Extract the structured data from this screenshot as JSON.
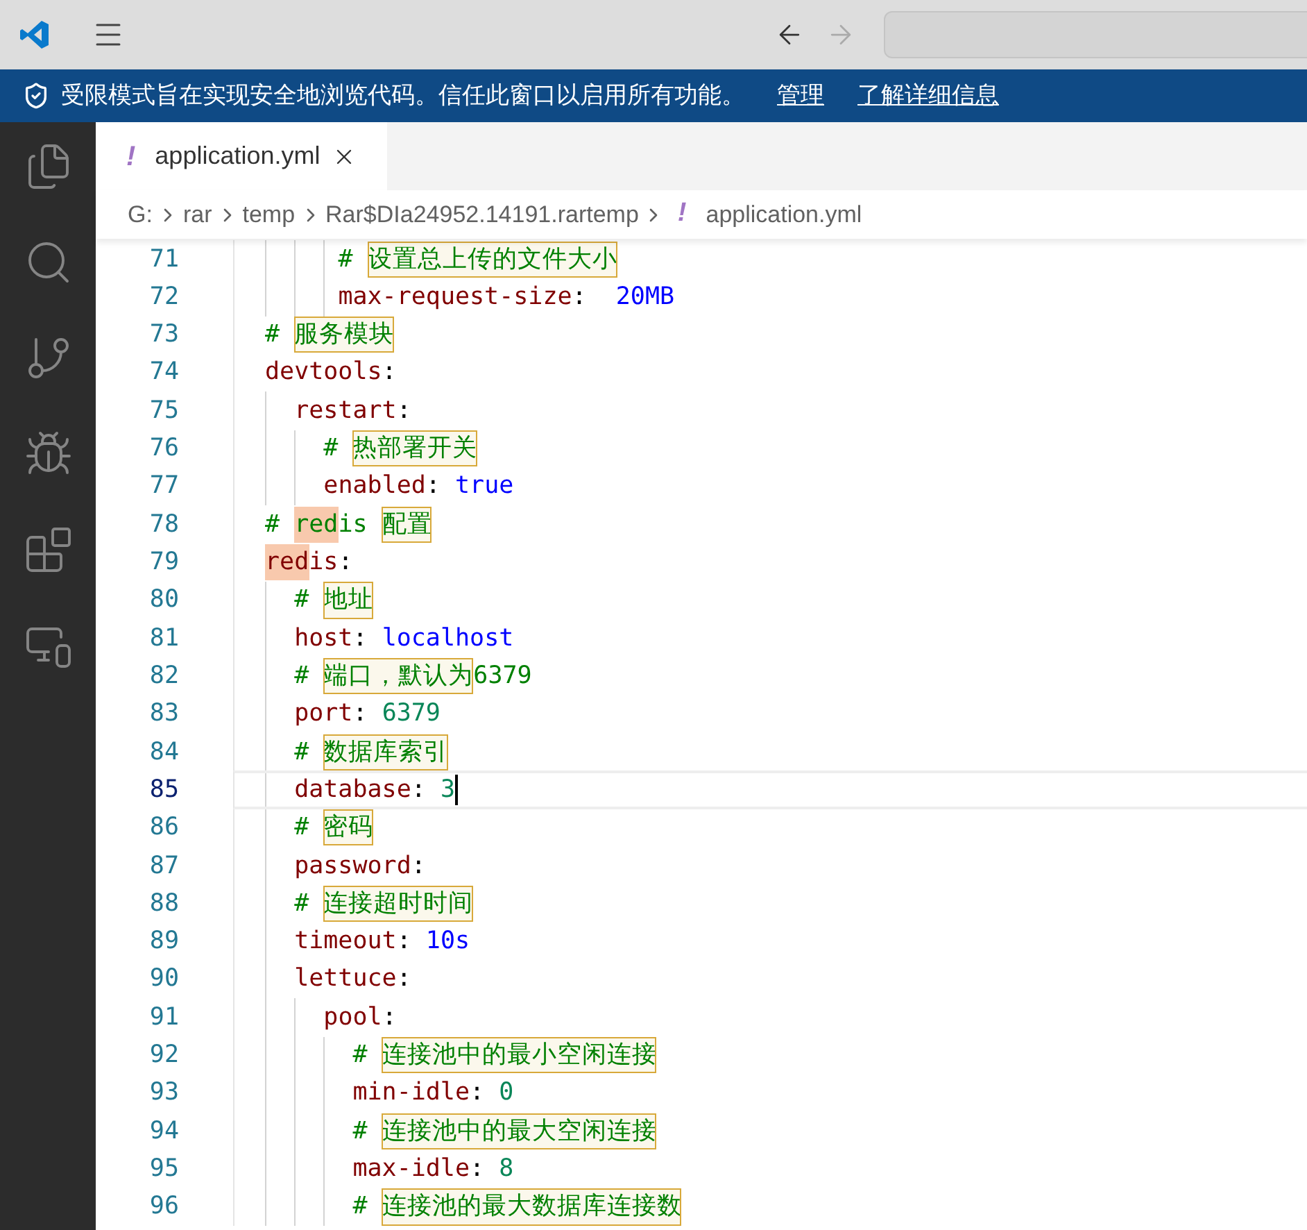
{
  "banner": {
    "message": "受限模式旨在实现安全地浏览代码。信任此窗口以启用所有功能。",
    "links": [
      "管理",
      "了解详细信息"
    ]
  },
  "tabs": [
    {
      "icon": "!",
      "label": "application.yml",
      "selected": true
    }
  ],
  "breadcrumb": {
    "parts": [
      "G:",
      "rar",
      "temp",
      "Rar$DIa24952.14191.rartemp"
    ],
    "file_icon": "!",
    "file": "application.yml"
  },
  "lines": [
    {
      "number": "71",
      "current": false,
      "segments": [
        {
          "kind": "comment",
          "text": "     # "
        },
        {
          "kind": "boxed",
          "text": "设置总上传的文件大小"
        }
      ]
    },
    {
      "number": "72",
      "current": false,
      "segments": [
        {
          "kind": "key",
          "text": "     max-request-size"
        },
        {
          "kind": "punct",
          "text": ":  "
        },
        {
          "kind": "string",
          "text": "20MB"
        }
      ]
    },
    {
      "number": "73",
      "current": false,
      "segments": [
        {
          "kind": "comment",
          "text": "# "
        },
        {
          "kind": "boxed",
          "text": "服务模块"
        }
      ]
    },
    {
      "number": "74",
      "current": false,
      "segments": [
        {
          "kind": "key",
          "text": "devtools"
        },
        {
          "kind": "punct",
          "text": ":"
        }
      ]
    },
    {
      "number": "75",
      "current": false,
      "segments": [
        {
          "kind": "key",
          "text": "  restart"
        },
        {
          "kind": "punct",
          "text": ":"
        }
      ]
    },
    {
      "number": "76",
      "current": false,
      "segments": [
        {
          "kind": "comment",
          "text": "    # "
        },
        {
          "kind": "boxed",
          "text": "热部署开关"
        }
      ]
    },
    {
      "number": "77",
      "current": false,
      "segments": [
        {
          "kind": "key",
          "text": "    enabled"
        },
        {
          "kind": "punct",
          "text": ": "
        },
        {
          "kind": "string",
          "text": "true"
        }
      ]
    },
    {
      "number": "78",
      "current": false,
      "segments": [
        {
          "kind": "comment",
          "text": "# "
        },
        {
          "kind": "match",
          "text": "red"
        },
        {
          "kind": "comment",
          "text": "is "
        },
        {
          "kind": "boxed",
          "text": "配置"
        }
      ]
    },
    {
      "number": "79",
      "current": false,
      "segments": [
        {
          "kind": "keymatch",
          "text": "red"
        },
        {
          "kind": "key",
          "text": "is"
        },
        {
          "kind": "punct",
          "text": ":"
        }
      ]
    },
    {
      "number": "80",
      "current": false,
      "segments": [
        {
          "kind": "comment",
          "text": "  # "
        },
        {
          "kind": "boxed",
          "text": "地址"
        }
      ]
    },
    {
      "number": "81",
      "current": false,
      "segments": [
        {
          "kind": "key",
          "text": "  host"
        },
        {
          "kind": "punct",
          "text": ": "
        },
        {
          "kind": "string",
          "text": "localhost"
        }
      ]
    },
    {
      "number": "82",
      "current": false,
      "segments": [
        {
          "kind": "comment",
          "text": "  # "
        },
        {
          "kind": "boxed",
          "text": "端口，默认为"
        },
        {
          "kind": "comment",
          "text": "6379"
        }
      ]
    },
    {
      "number": "83",
      "current": false,
      "segments": [
        {
          "kind": "key",
          "text": "  port"
        },
        {
          "kind": "punct",
          "text": ": "
        },
        {
          "kind": "number",
          "text": "6379"
        }
      ]
    },
    {
      "number": "84",
      "current": false,
      "segments": [
        {
          "kind": "comment",
          "text": "  # "
        },
        {
          "kind": "boxed",
          "text": "数据库索引"
        }
      ]
    },
    {
      "number": "85",
      "current": true,
      "segments": [
        {
          "kind": "key",
          "text": "  database"
        },
        {
          "kind": "punct",
          "text": ": "
        },
        {
          "kind": "number",
          "text": "3"
        }
      ]
    },
    {
      "number": "86",
      "current": false,
      "segments": [
        {
          "kind": "comment",
          "text": "  # "
        },
        {
          "kind": "boxed",
          "text": "密码"
        }
      ]
    },
    {
      "number": "87",
      "current": false,
      "segments": [
        {
          "kind": "key",
          "text": "  password"
        },
        {
          "kind": "punct",
          "text": ":"
        }
      ]
    },
    {
      "number": "88",
      "current": false,
      "segments": [
        {
          "kind": "comment",
          "text": "  # "
        },
        {
          "kind": "boxed",
          "text": "连接超时时间"
        }
      ]
    },
    {
      "number": "89",
      "current": false,
      "segments": [
        {
          "kind": "key",
          "text": "  timeout"
        },
        {
          "kind": "punct",
          "text": ": "
        },
        {
          "kind": "string",
          "text": "10s"
        }
      ]
    },
    {
      "number": "90",
      "current": false,
      "segments": [
        {
          "kind": "key",
          "text": "  lettuce"
        },
        {
          "kind": "punct",
          "text": ":"
        }
      ]
    },
    {
      "number": "91",
      "current": false,
      "segments": [
        {
          "kind": "key",
          "text": "    pool"
        },
        {
          "kind": "punct",
          "text": ":"
        }
      ]
    },
    {
      "number": "92",
      "current": false,
      "segments": [
        {
          "kind": "comment",
          "text": "      # "
        },
        {
          "kind": "boxed",
          "text": "连接池中的最小空闲连接"
        }
      ]
    },
    {
      "number": "93",
      "current": false,
      "segments": [
        {
          "kind": "key",
          "text": "      min-idle"
        },
        {
          "kind": "punct",
          "text": ": "
        },
        {
          "kind": "number",
          "text": "0"
        }
      ]
    },
    {
      "number": "94",
      "current": false,
      "segments": [
        {
          "kind": "comment",
          "text": "      # "
        },
        {
          "kind": "boxed",
          "text": "连接池中的最大空闲连接"
        }
      ]
    },
    {
      "number": "95",
      "current": false,
      "segments": [
        {
          "kind": "key",
          "text": "      max-idle"
        },
        {
          "kind": "punct",
          "text": ": "
        },
        {
          "kind": "number",
          "text": "8"
        }
      ]
    },
    {
      "number": "96",
      "current": false,
      "segments": [
        {
          "kind": "comment",
          "text": "      # "
        },
        {
          "kind": "boxed",
          "text": "连接池的最大数据库连接数"
        }
      ]
    }
  ]
}
